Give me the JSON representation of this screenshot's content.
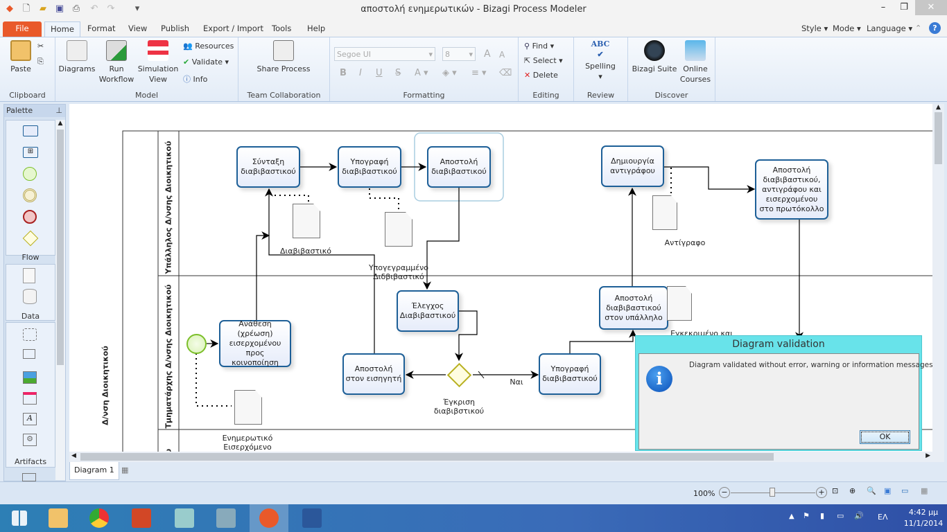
{
  "window": {
    "title": "αποστολή ενημερωτικών - Bizagi Process Modeler"
  },
  "menu_tabs": [
    "File",
    "Home",
    "Format",
    "View",
    "Publish",
    "Export / Import",
    "Tools",
    "Help"
  ],
  "menu_right": {
    "style": "Style",
    "mode": "Mode",
    "language": "Language"
  },
  "ribbon": {
    "clipboard": {
      "label": "Clipboard",
      "paste": "Paste"
    },
    "model": {
      "label": "Model",
      "diagrams": "Diagrams",
      "run_workflow": "Run\nWorkflow",
      "simulation_view": "Simulation\nView",
      "resources": "Resources",
      "validate": "Validate",
      "info": "Info"
    },
    "team": {
      "label": "Team Collaboration",
      "share": "Share Process"
    },
    "formatting": {
      "label": "Formatting",
      "font": "Segoe UI",
      "size": "8",
      "bold": "B",
      "italic": "I",
      "underline": "U",
      "strike": "S"
    },
    "editing": {
      "label": "Editing",
      "find": "Find",
      "select": "Select",
      "delete": "Delete"
    },
    "review": {
      "label": "Review",
      "spelling": "Spelling"
    },
    "discover": {
      "label": "Discover",
      "suite": "Bizagi Suite",
      "courses": "Online\nCourses"
    }
  },
  "palette": {
    "title": "Palette",
    "sections": [
      "Flow",
      "Data",
      "Artifacts"
    ]
  },
  "diagram": {
    "pool": "Δ/νση Διοικητικού",
    "lanes": [
      "Υπάλληλος Δ/νσης Διοικητικού",
      "Τμηματάρχης Δ/νσης Διοικητικού",
      "υ"
    ],
    "tasks": {
      "t1": "Σύνταξη διαβιβαστικού",
      "t2": "Υπογραφή διαβιβαστικού",
      "t3": "Αποστολή διαβιβαστικού",
      "t4": "Δημιουργία αντιγράφου",
      "t5": "Αποστολή διαβιβαστικού, αντιγράφου και εισερχομένου στο πρωτόκολλο",
      "t6": "Έλεγχος Διαβιβαστικού",
      "t7": "Ανάθεση (χρέωση) εισερχομένου προς κοινοποίηση",
      "t8": "Αποστολή στον εισηγητή",
      "t9": "Υπογραφή διαβιβαστικού",
      "t10": "Αποστολή διαβιβαστικού στον υπάλληλο"
    },
    "documents": {
      "d1": "Διαβιβαστικό",
      "d2": "Υπογεγραμμένο Διδβιβαστικό",
      "d3": "Αντίγραφο",
      "d4": "Εγκεκριμένο και",
      "d5": "Ενημερωτικό Εισερχόμενο"
    },
    "gateway": "Έγκριση διαβιβστικού",
    "yes_label": "Ναι"
  },
  "doc_tab": "Diagram 1",
  "status": {
    "zoom": "100%",
    "zoom_level_percent": 100
  },
  "dialog": {
    "title": "Diagram validation",
    "message": "Diagram validated without error, warning or information messages",
    "ok": "OK"
  },
  "taskbar": {
    "lang": "ΕΛ",
    "time": "4:42 μμ",
    "date": "11/1/2014"
  },
  "colors": {
    "accent": "#1d5f97",
    "file_tab": "#e9592a",
    "dialog_title": "#68e3ea",
    "taskbar": "#3a6bb8"
  }
}
